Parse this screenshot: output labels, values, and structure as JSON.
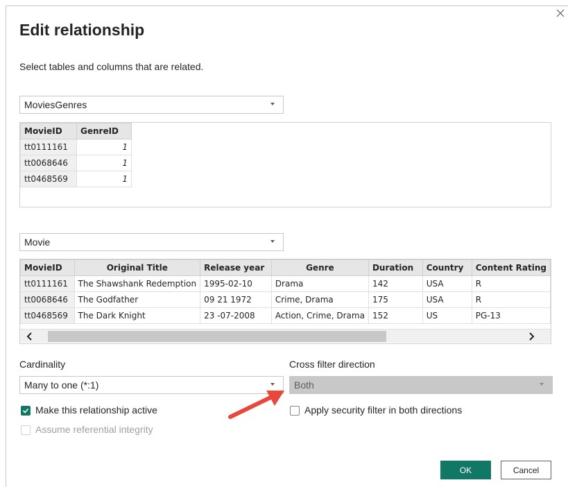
{
  "dialog": {
    "title": "Edit relationship",
    "subtitle": "Select tables and columns that are related."
  },
  "table1": {
    "selected": "MoviesGenres",
    "columns": [
      "MovieID",
      "GenreID"
    ],
    "rows": [
      [
        "tt0111161",
        "1"
      ],
      [
        "tt0068646",
        "1"
      ],
      [
        "tt0468569",
        "1"
      ]
    ]
  },
  "table2": {
    "selected": "Movie",
    "columns": [
      "MovieID",
      "Original Title",
      "Release year",
      "Genre",
      "Duration",
      "Country",
      "Content Rating"
    ],
    "rows": [
      [
        "tt0111161",
        "The Shawshank Redemption",
        "1995-02-10",
        "Drama",
        "142",
        "USA",
        "R"
      ],
      [
        "tt0068646",
        "The Godfather",
        "09 21 1972",
        "Crime, Drama",
        "175",
        "USA",
        "R"
      ],
      [
        "tt0468569",
        "The Dark Knight",
        " 23 -07-2008",
        "Action, Crime, Drama",
        "152",
        "US",
        "PG-13"
      ]
    ]
  },
  "cardinality": {
    "label": "Cardinality",
    "value": "Many to one (*:1)"
  },
  "cross_filter": {
    "label": "Cross filter direction",
    "value": "Both"
  },
  "options": {
    "make_active": "Make this relationship active",
    "referential": "Assume referential integrity",
    "security": "Apply security filter in both directions"
  },
  "buttons": {
    "ok": "OK",
    "cancel": "Cancel"
  },
  "colors": {
    "accent": "#117865",
    "arrow": "#e8473c"
  },
  "icons": {
    "close": "close-icon",
    "chevron_down": "chevron-down-icon",
    "scroll_left": "chevron-left-icon",
    "scroll_right": "chevron-right-icon",
    "check": "checkmark-icon",
    "annotation": "red-arrow"
  }
}
